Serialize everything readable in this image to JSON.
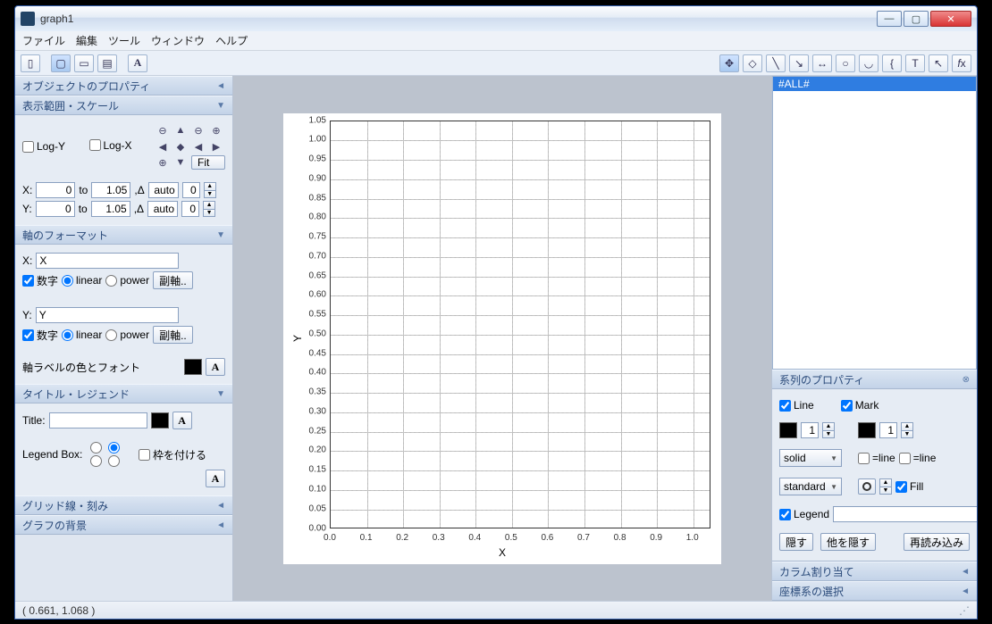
{
  "window": {
    "title": "graph1"
  },
  "menu": {
    "file": "ファイル",
    "edit": "編集",
    "tool": "ツール",
    "window": "ウィンドウ",
    "help": "ヘルプ"
  },
  "left": {
    "sec_obj": "オブジェクトのプロパティ",
    "sec_range": "表示範囲・スケール",
    "logy": "Log-Y",
    "logx": "Log-X",
    "fit": "Fit",
    "xlabel": "X:",
    "ylabel": "Y:",
    "to": "to",
    "auto": "auto",
    "delta": ",Δ",
    "xmin": "0",
    "xmax": "1.05",
    "ymin": "0",
    "ymax": "1.05",
    "stepx": "0",
    "stepy": "0",
    "sec_axis": "軸のフォーマット",
    "xfield_label": "X:",
    "xfield": "X",
    "yfield_label": "Y:",
    "yfield": "Y",
    "suuji": "数字",
    "linear": "linear",
    "power": "power",
    "subaxis": "副軸..",
    "axislabel_color": "軸ラベルの色とフォント",
    "sec_title": "タイトル・レジェンド",
    "title": "Title:",
    "legendbox": "Legend Box:",
    "frame": "枠を付ける",
    "sec_grid": "グリッド線・刻み",
    "sec_bg": "グラフの背景"
  },
  "right": {
    "all": "#ALL#",
    "sec_series": "系列のプロパティ",
    "line": "Line",
    "mark": "Mark",
    "lineval": "1",
    "markval": "1",
    "style": "solid",
    "marker": "standard",
    "eqline": "=line",
    "fill": "Fill",
    "legend": "Legend",
    "hide": "隠す",
    "hideothers": "他を隠す",
    "reload": "再読み込み",
    "sec_col": "カラム割り当て",
    "sec_coord": "座標系の選択"
  },
  "status": {
    "coords": "( 0.661,  1.068 )"
  },
  "chart_data": {
    "type": "scatter",
    "title": "",
    "xlabel": "X",
    "ylabel": "Y",
    "xlim": [
      0,
      1.05
    ],
    "ylim": [
      0,
      1.05
    ],
    "xticks": [
      0.0,
      0.1,
      0.2,
      0.3,
      0.4,
      0.5,
      0.6,
      0.7,
      0.8,
      0.9,
      1.0
    ],
    "yticks": [
      0.0,
      0.05,
      0.1,
      0.15,
      0.2,
      0.25,
      0.3,
      0.35,
      0.4,
      0.45,
      0.5,
      0.55,
      0.6,
      0.65,
      0.7,
      0.75,
      0.8,
      0.85,
      0.9,
      0.95,
      1.0,
      1.05
    ],
    "series": []
  }
}
